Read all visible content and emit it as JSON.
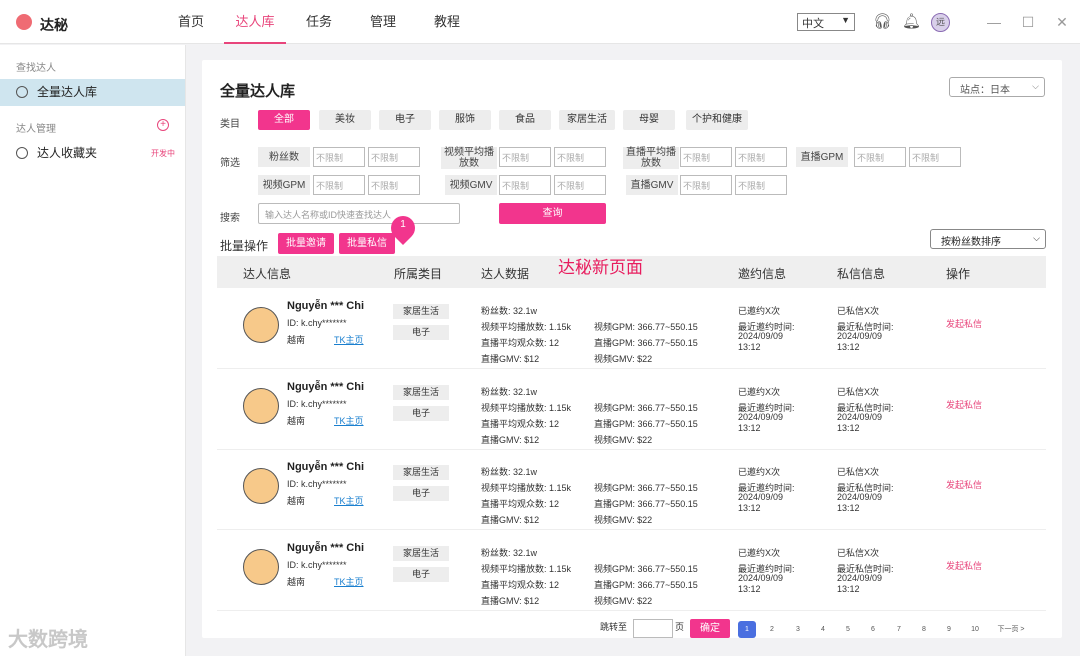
{
  "app": {
    "name": "达秘"
  },
  "nav": {
    "items": [
      "首页",
      "达人库",
      "任务",
      "管理",
      "教程"
    ],
    "active": 1
  },
  "header": {
    "lang": "中文",
    "avatar_text": "远"
  },
  "sidebar": {
    "section_find": "查找达人",
    "item_all": "全量达人库",
    "section_manage": "达人管理",
    "item_fav": "达人收藏夹",
    "fav_badge": "开发中"
  },
  "main": {
    "title": "全量达人库",
    "site_select": "站点：日本",
    "category_label": "类目",
    "categories": [
      "全部",
      "美妆",
      "电子",
      "服饰",
      "食品",
      "家居生活",
      "母婴",
      "个护和健康"
    ],
    "filter_label": "筛选",
    "filters": [
      {
        "name": "粉丝数"
      },
      {
        "name": "视频平均播放数"
      },
      {
        "name": "直播平均播放数"
      },
      {
        "name": "直播GPM"
      },
      {
        "name": "视频GPM"
      },
      {
        "name": "视频GMV"
      },
      {
        "name": "直播GMV"
      }
    ],
    "filter_placeholder": "不限制",
    "search_label": "搜索",
    "search_placeholder": "输入达人名称或ID快速查找达人",
    "search_button": "查询",
    "batch_label": "批量操作",
    "batch_invite": "批量邀请",
    "batch_message": "批量私信",
    "pin_number": "1",
    "annotation": "达秘新页面",
    "sort_select": "按粉丝数排序",
    "columns": [
      "达人信息",
      "所属类目",
      "达人数据",
      "邀约信息",
      "私信信息",
      "操作"
    ],
    "rows": [
      {
        "name": "Nguyễn *** Chi",
        "id": "ID: k.chy*******",
        "country": "越南",
        "tk_link": "TK主页",
        "tags": [
          "家居生活",
          "电子"
        ],
        "fans": "粉丝数:  32.1w",
        "video_avg": "视频平均播放数:  1.15k",
        "live_avg": "直播平均观众数:  12",
        "live_gmv": "直播GMV:  $12",
        "video_gpm": "视频GPM:  366.77~550.15",
        "live_gpm": "直播GPM:  366.77~550.15",
        "video_gmv": "视频GMV:  $22",
        "invite_count": "已邀约X次",
        "invite_time_label": "最近邀约时间:",
        "invite_date": "2024/09/09",
        "invite_clock": "13:12",
        "msg_count": "已私信X次",
        "msg_time_label": "最近私信时间:",
        "msg_date": "2024/09/09",
        "msg_clock": "13:12",
        "action": "发起私信"
      },
      {
        "name": "Nguyễn *** Chi",
        "id": "ID: k.chy*******",
        "country": "越南",
        "tk_link": "TK主页",
        "tags": [
          "家居生活",
          "电子"
        ],
        "fans": "粉丝数:  32.1w",
        "video_avg": "视频平均播放数:  1.15k",
        "live_avg": "直播平均观众数:  12",
        "live_gmv": "直播GMV:  $12",
        "video_gpm": "视频GPM:  366.77~550.15",
        "live_gpm": "直播GPM:  366.77~550.15",
        "video_gmv": "视频GMV:  $22",
        "invite_count": "已邀约X次",
        "invite_time_label": "最近邀约时间:",
        "invite_date": "2024/09/09",
        "invite_clock": "13:12",
        "msg_count": "已私信X次",
        "msg_time_label": "最近私信时间:",
        "msg_date": "2024/09/09",
        "msg_clock": "13:12",
        "action": "发起私信"
      },
      {
        "name": "Nguyễn *** Chi",
        "id": "ID: k.chy*******",
        "country": "越南",
        "tk_link": "TK主页",
        "tags": [
          "家居生活",
          "电子"
        ],
        "fans": "粉丝数:  32.1w",
        "video_avg": "视频平均播放数:  1.15k",
        "live_avg": "直播平均观众数:  12",
        "live_gmv": "直播GMV:  $12",
        "video_gpm": "视频GPM:  366.77~550.15",
        "live_gpm": "直播GPM:  366.77~550.15",
        "video_gmv": "视频GMV:  $22",
        "invite_count": "已邀约X次",
        "invite_time_label": "最近邀约时间:",
        "invite_date": "2024/09/09",
        "invite_clock": "13:12",
        "msg_count": "已私信X次",
        "msg_time_label": "最近私信时间:",
        "msg_date": "2024/09/09",
        "msg_clock": "13:12",
        "action": "发起私信"
      },
      {
        "name": "Nguyễn *** Chi",
        "id": "ID: k.chy*******",
        "country": "越南",
        "tk_link": "TK主页",
        "tags": [
          "家居生活",
          "电子"
        ],
        "fans": "粉丝数:  32.1w",
        "video_avg": "视频平均播放数:  1.15k",
        "live_avg": "直播平均观众数:  12",
        "live_gmv": "直播GMV:  $12",
        "video_gpm": "视频GPM:  366.77~550.15",
        "live_gpm": "直播GPM:  366.77~550.15",
        "video_gmv": "视频GMV:  $22",
        "invite_count": "已邀约X次",
        "invite_time_label": "最近邀约时间:",
        "invite_date": "2024/09/09",
        "invite_clock": "13:12",
        "msg_count": "已私信X次",
        "msg_time_label": "最近私信时间:",
        "msg_date": "2024/09/09",
        "msg_clock": "13:12",
        "action": "发起私信"
      }
    ],
    "pagination": {
      "jump_label": "跳转至",
      "page_unit": "页",
      "confirm": "确定",
      "pages": [
        "1",
        "2",
        "3",
        "4",
        "5",
        "6",
        "7",
        "8",
        "9",
        "10"
      ],
      "next": "下一页 >",
      "current": "1"
    }
  },
  "watermark": "大数跨境"
}
